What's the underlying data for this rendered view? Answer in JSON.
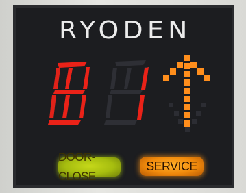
{
  "indicator": {
    "brand": "RYODEN",
    "floor_display": {
      "digit_1": "B",
      "digit_2": "1",
      "direction": "up"
    },
    "buttons": {
      "door_close": "DOOR-CLOSE",
      "service": "SERVICE"
    }
  },
  "colors": {
    "panel": "#1c1d20",
    "digit_on": "#e8201a",
    "digit_off": "#34343a",
    "arrow_on": "#ff8a1a",
    "door_close": "#b5cc14",
    "service": "#f59a1a"
  }
}
